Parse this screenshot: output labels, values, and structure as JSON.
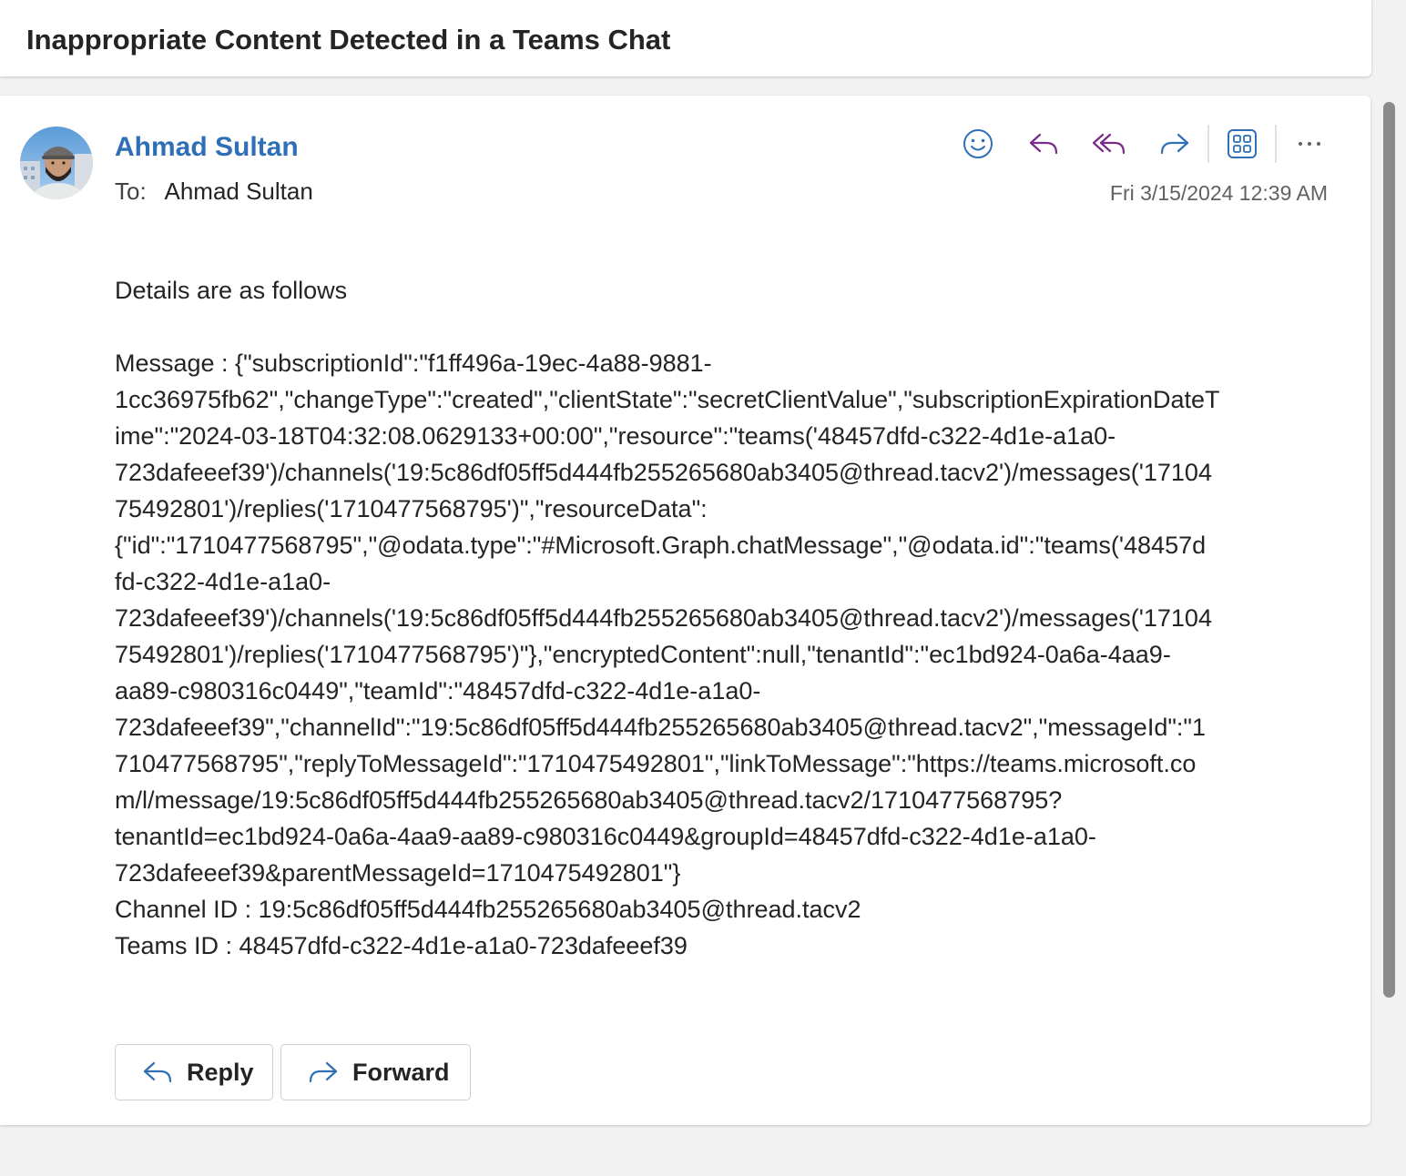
{
  "subject": "Inappropriate Content Detected in a Teams Chat",
  "message": {
    "sender_name": "Ahmad Sultan",
    "to_label": "To:",
    "to_value": "Ahmad Sultan",
    "date": "Fri 3/15/2024 12:39 AM",
    "body_lines": [
      "Details are as follows",
      "",
      "Message : {\"subscriptionId\":\"f1ff496a-19ec-4a88-9881-",
      "1cc36975fb62\",\"changeType\":\"created\",\"clientState\":\"secretClientValue\",\"subscriptionExpirationDateT",
      "ime\":\"2024-03-18T04:32:08.0629133+00:00\",\"resource\":\"teams('48457dfd-c322-4d1e-a1a0-",
      "723dafeeef39')/channels('19:5c86df05ff5d444fb255265680ab3405@thread.tacv2')/messages('17104",
      "75492801')/replies('1710477568795')\",\"resourceData\":",
      "{\"id\":\"1710477568795\",\"@odata.type\":\"#Microsoft.Graph.chatMessage\",\"@odata.id\":\"teams('48457d",
      "fd-c322-4d1e-a1a0-",
      "723dafeeef39')/channels('19:5c86df05ff5d444fb255265680ab3405@thread.tacv2')/messages('17104",
      "75492801')/replies('1710477568795')\"},\"encryptedContent\":null,\"tenantId\":\"ec1bd924-0a6a-4aa9-",
      "aa89-c980316c0449\",\"teamId\":\"48457dfd-c322-4d1e-a1a0-",
      "723dafeeef39\",\"channelId\":\"19:5c86df05ff5d444fb255265680ab3405@thread.tacv2\",\"messageId\":\"1",
      "710477568795\",\"replyToMessageId\":\"1710475492801\",\"linkToMessage\":\"https://teams.microsoft.co",
      "m/l/message/19:5c86df05ff5d444fb255265680ab3405@thread.tacv2/1710477568795?",
      "tenantId=ec1bd924-0a6a-4aa9-aa89-c980316c0449&groupId=48457dfd-c322-4d1e-a1a0-",
      "723dafeeef39&parentMessageId=1710475492801\"}",
      "Channel ID : 19:5c86df05ff5d444fb255265680ab3405@thread.tacv2",
      "Teams ID : 48457dfd-c322-4d1e-a1a0-723dafeeef39"
    ]
  },
  "toolbar": {
    "icons": [
      "emoji-icon",
      "reply-icon",
      "reply-all-icon",
      "forward-icon",
      "apps-icon",
      "more-icon"
    ]
  },
  "actions": {
    "reply_label": "Reply",
    "forward_label": "Forward"
  },
  "colors": {
    "accent": "#2f6fb7",
    "reply_purple": "#7a2a8a",
    "forward_blue": "#2f6fb7",
    "background": "#f2f2f2"
  }
}
